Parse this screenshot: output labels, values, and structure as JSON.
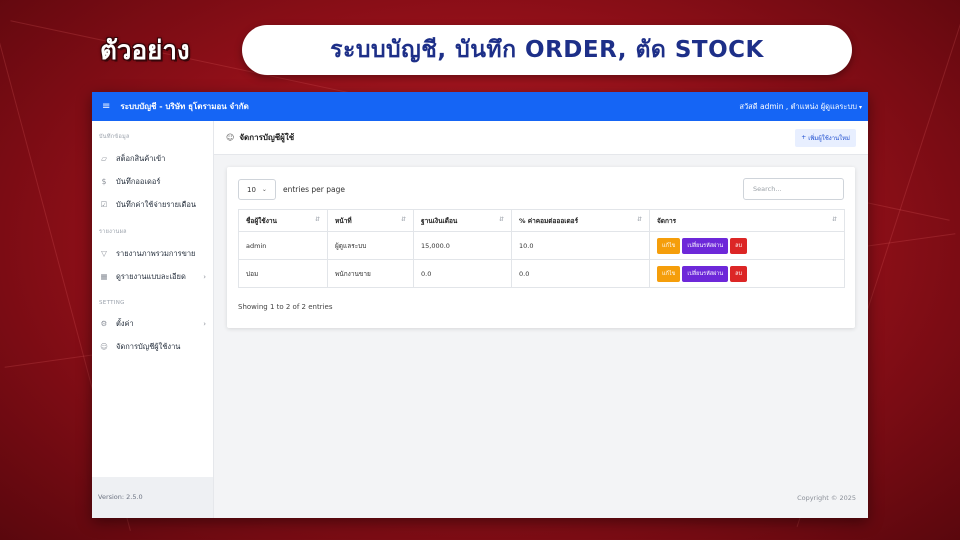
{
  "promo": {
    "badge": "ตัวอย่าง",
    "headline": "ระบบบัญชี, บันทึก ORDER, ตัด STOCK"
  },
  "topbar": {
    "menu_icon": "hamburger-icon",
    "title": "ระบบบัญชี - บริษัท ธุโตรามอน จำกัด",
    "user": "สวัสดี admin , ตำแหน่ง ผู้ดูแลระบบ"
  },
  "sidebar": {
    "sections": [
      {
        "label": "บันทึกข้อมูล"
      },
      {
        "label": "รายงานผล"
      },
      {
        "label": "SETTING"
      }
    ],
    "items": [
      {
        "label": "สต็อกสินค้าเข้า",
        "icon": "box-icon"
      },
      {
        "label": "บันทึกออเดอร์",
        "icon": "dollar-icon"
      },
      {
        "label": "บันทึกค่าใช้จ่ายรายเดือน",
        "icon": "cart-icon"
      },
      {
        "label": "รายงานภาพรวมการขาย",
        "icon": "filter-icon"
      },
      {
        "label": "ดูรายงานแบบละเอียด",
        "icon": "grid-icon"
      },
      {
        "label": "ตั้งค่า",
        "icon": "gear-icon"
      },
      {
        "label": "จัดการบัญชีผู้ใช้งาน",
        "icon": "user-icon"
      }
    ],
    "version": "Version: 2.5.0"
  },
  "page": {
    "title": "จัดการบัญชีผู้ใช้",
    "add_button": "เพิ่มผู้ใช้งานใหม่"
  },
  "table": {
    "page_length": "10",
    "entries_label": "entries per page",
    "search_placeholder": "Search...",
    "columns": [
      "ชื่อผู้ใช้งาน",
      "หน้าที่",
      "ฐานเงินเดือน",
      "% ค่าคอมต่อออเดอร์",
      "จัดการ"
    ],
    "rows": [
      {
        "username": "admin",
        "role": "ผู้ดูแลระบบ",
        "salary": "15,000.0",
        "commission": "10.0"
      },
      {
        "username": "บ่อม",
        "role": "พนักงานขาย",
        "salary": "0.0",
        "commission": "0.0"
      }
    ],
    "actions": {
      "edit": "แก้ไข",
      "change_password": "เปลี่ยนรหัสผ่าน",
      "delete": "ลบ"
    },
    "info": "Showing 1 to 2 of 2 entries"
  },
  "footer": {
    "copyright": "Copyright © 2025"
  }
}
